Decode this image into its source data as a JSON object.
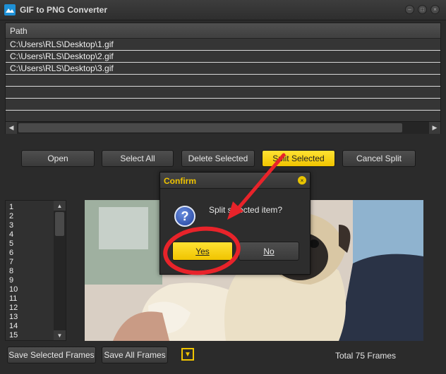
{
  "window": {
    "title": "GIF to PNG Converter",
    "icon": "app-logo-icon",
    "controls": [
      "minimize-icon",
      "restore-icon",
      "close-icon"
    ]
  },
  "file_list": {
    "column_header": "Path",
    "rows": [
      "C:\\Users\\RLS\\Desktop\\1.gif",
      "C:\\Users\\RLS\\Desktop\\2.gif",
      "C:\\Users\\RLS\\Desktop\\3.gif",
      "",
      "",
      "",
      ""
    ]
  },
  "toolbar": {
    "open": "Open",
    "select_all": "Select All",
    "delete_selected": "Delete Selected",
    "split_selected": "Split Selected",
    "cancel_split": "Cancel Split"
  },
  "frames": {
    "items": [
      "1",
      "2",
      "3",
      "4",
      "5",
      "6",
      "7",
      "8",
      "9",
      "10",
      "11",
      "12",
      "13",
      "14",
      "15"
    ]
  },
  "bottom": {
    "save_selected": "Save Selected Frames",
    "save_all": "Save All Frames",
    "total": "Total 75 Frames"
  },
  "dialog": {
    "title": "Confirm",
    "message": "Split selected item?",
    "yes": "Yes",
    "no": "No"
  },
  "colors": {
    "accent": "#f0c400",
    "background": "#2b2b2b",
    "annotation": "#e8232a"
  }
}
